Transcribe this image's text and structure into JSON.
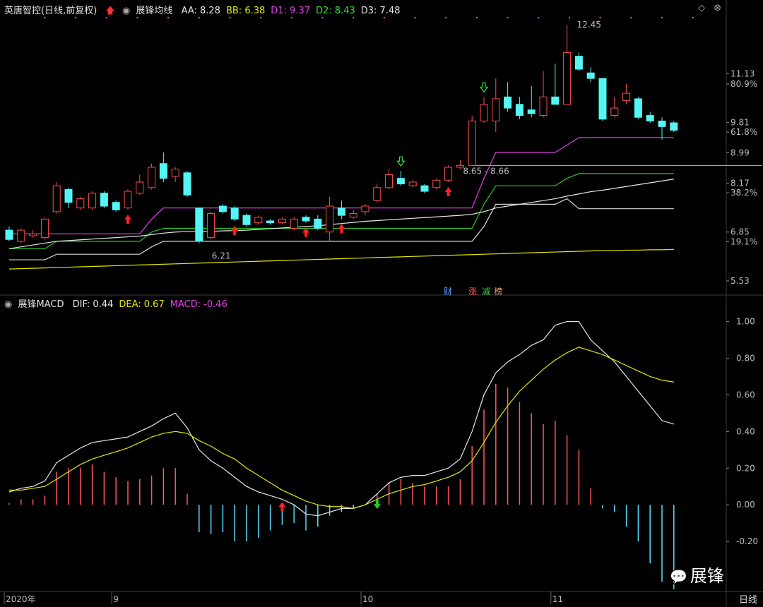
{
  "colors": {
    "bg": "#000000",
    "grid": "#3a3a3a",
    "up": "#ff4d4d",
    "down": "#54f5f5",
    "aa": "#e040e0",
    "bb": "#ffffff",
    "d1": "#e040e0",
    "d2": "#22cc22",
    "d3": "#d8d8d8",
    "dif": "#e6e6e6",
    "dea": "#e6e600",
    "macd_pos": "#ff5a5a",
    "macd_neg": "#54e0ff"
  },
  "header": {
    "stock": "英唐智控(日线,前复权)",
    "indicator": "展锋均线",
    "values": [
      {
        "label": "AA: 8.28",
        "color": "#e6e6e6"
      },
      {
        "label": "BB: 6.38",
        "color": "#e6e600"
      },
      {
        "label": "D1: 9.37",
        "color": "#e040e0"
      },
      {
        "label": "D2: 8.43",
        "color": "#33dd33"
      },
      {
        "label": "D3: 7.48",
        "color": "#e6e6e6"
      }
    ]
  },
  "macd_header": {
    "name": "展锋MACD",
    "values": [
      {
        "label": "DIF: 0.44",
        "color": "#e6e6e6"
      },
      {
        "label": "DEA: 0.67",
        "color": "#e6e600"
      },
      {
        "label": "MACD: -0.46",
        "color": "#e040e0"
      }
    ]
  },
  "price_axis": {
    "labels": [
      {
        "v": 11.13,
        "t": "11.13"
      },
      {
        "v": 10.85,
        "t": "80.9%"
      },
      {
        "v": 9.81,
        "t": "9.81"
      },
      {
        "v": 9.55,
        "t": "61.8%"
      },
      {
        "v": 8.99,
        "t": "8.99"
      },
      {
        "v": 8.17,
        "t": "8.17"
      },
      {
        "v": 7.91,
        "t": "38.2%"
      },
      {
        "v": 6.85,
        "t": "6.85"
      },
      {
        "v": 6.59,
        "t": "19.1%"
      },
      {
        "v": 5.53,
        "t": "5.53"
      }
    ]
  },
  "macd_axis": {
    "labels": [
      "1.00",
      "0.80",
      "0.60",
      "0.40",
      "0.20",
      "0.00",
      "-0.20"
    ],
    "values": [
      1.0,
      0.8,
      0.6,
      0.4,
      0.2,
      0.0,
      -0.2
    ]
  },
  "date_axis": [
    {
      "label": "2020年",
      "index": 0
    },
    {
      "label": "9",
      "index": 9
    },
    {
      "label": "10",
      "index": 30
    },
    {
      "label": "11",
      "index": 46
    }
  ],
  "period_label": "日线",
  "annotations": {
    "high": "12.45",
    "low": "6.21",
    "range": "8.65 - 8.66"
  },
  "badges": [
    {
      "text": "财",
      "color": "#5aa0ff"
    },
    {
      "text": "涨",
      "color": "#ff4d4d"
    },
    {
      "text": "减",
      "color": "#33dd33"
    },
    {
      "text": "榜",
      "color": "#e6a060"
    }
  ],
  "watermark": "展锋",
  "chart_data": [
    {
      "type": "candlestick",
      "title": "展锋均线",
      "ylim": [
        5.3,
        12.7
      ],
      "candles": [
        [
          6.9,
          6.65,
          7.0,
          6.6
        ],
        [
          6.6,
          6.9,
          6.95,
          6.55
        ],
        [
          6.75,
          6.8,
          6.9,
          6.7
        ],
        [
          6.7,
          7.2,
          7.25,
          6.65
        ],
        [
          7.4,
          8.1,
          8.2,
          7.35
        ],
        [
          8.0,
          7.65,
          8.05,
          7.5
        ],
        [
          7.5,
          7.75,
          7.8,
          7.45
        ],
        [
          7.5,
          7.9,
          7.95,
          7.45
        ],
        [
          7.9,
          7.55,
          7.95,
          7.5
        ],
        [
          7.65,
          7.45,
          7.7,
          7.4
        ],
        [
          7.5,
          7.95,
          8.0,
          7.45
        ],
        [
          7.9,
          8.2,
          8.4,
          7.85
        ],
        [
          8.05,
          8.6,
          8.7,
          8.0
        ],
        [
          8.7,
          8.3,
          9.0,
          8.2
        ],
        [
          8.35,
          8.55,
          8.6,
          8.2
        ],
        [
          8.45,
          7.85,
          8.5,
          7.8
        ],
        [
          7.5,
          6.6,
          7.5,
          6.55
        ],
        [
          6.7,
          7.35,
          7.4,
          6.65
        ],
        [
          7.55,
          7.4,
          7.6,
          7.35
        ],
        [
          7.5,
          7.2,
          7.55,
          7.15
        ],
        [
          7.3,
          7.05,
          7.35,
          7.0
        ],
        [
          7.1,
          7.25,
          7.3,
          7.05
        ],
        [
          7.15,
          7.1,
          7.2,
          7.05
        ],
        [
          7.1,
          7.2,
          7.25,
          7.05
        ],
        [
          6.95,
          7.2,
          7.25,
          6.9
        ],
        [
          7.25,
          7.15,
          7.3,
          7.1
        ],
        [
          7.2,
          6.95,
          7.3,
          6.9
        ],
        [
          6.85,
          7.55,
          7.8,
          6.6
        ],
        [
          7.5,
          7.3,
          7.7,
          7.2
        ],
        [
          7.25,
          7.35,
          7.45,
          7.2
        ],
        [
          7.4,
          7.55,
          7.6,
          7.3
        ],
        [
          7.7,
          8.05,
          8.15,
          7.65
        ],
        [
          8.05,
          8.4,
          8.55,
          8.0
        ],
        [
          8.3,
          8.15,
          8.5,
          8.1
        ],
        [
          8.1,
          8.2,
          8.25,
          8.05
        ],
        [
          8.1,
          7.95,
          8.15,
          7.9
        ],
        [
          8.05,
          8.25,
          8.3,
          8.0
        ],
        [
          8.25,
          8.6,
          8.65,
          8.2
        ],
        [
          8.6,
          8.65,
          8.8,
          8.55
        ],
        [
          8.65,
          9.85,
          10.0,
          8.65
        ],
        [
          9.85,
          10.3,
          10.5,
          9.8
        ],
        [
          9.85,
          10.45,
          11.0,
          9.55
        ],
        [
          10.5,
          10.2,
          10.9,
          10.1
        ],
        [
          10.3,
          10.0,
          10.5,
          9.9
        ],
        [
          10.15,
          10.05,
          10.8,
          9.95
        ],
        [
          10.0,
          10.5,
          11.2,
          9.95
        ],
        [
          10.5,
          10.3,
          11.4,
          10.3
        ],
        [
          10.3,
          11.7,
          12.45,
          10.3
        ],
        [
          11.6,
          11.25,
          11.7,
          11.2
        ],
        [
          11.15,
          11.0,
          11.3,
          10.9
        ],
        [
          11.0,
          9.9,
          11.0,
          9.85
        ],
        [
          10.0,
          10.2,
          10.5,
          9.95
        ],
        [
          10.4,
          10.6,
          10.85,
          10.3
        ],
        [
          10.45,
          9.95,
          10.5,
          9.9
        ],
        [
          10.0,
          9.85,
          10.1,
          9.8
        ],
        [
          9.85,
          9.7,
          9.95,
          9.35
        ],
        [
          9.8,
          9.6,
          9.85,
          9.55
        ]
      ],
      "series": [
        {
          "name": "D1",
          "color": "#e040e0",
          "values": [
            6.8,
            6.8,
            6.8,
            6.8,
            6.8,
            6.8,
            6.8,
            6.8,
            6.8,
            6.8,
            6.8,
            6.8,
            7.2,
            7.5,
            7.5,
            7.5,
            7.5,
            7.5,
            7.5,
            7.5,
            7.5,
            7.5,
            7.5,
            7.5,
            7.5,
            7.5,
            7.5,
            7.5,
            7.5,
            7.5,
            7.5,
            7.5,
            7.5,
            7.5,
            7.5,
            7.5,
            7.5,
            7.5,
            7.5,
            7.5,
            8.3,
            9.0,
            9.0,
            9.0,
            9.0,
            9.0,
            9.0,
            9.2,
            9.4,
            9.4,
            9.4,
            9.4,
            9.4,
            9.4,
            9.4,
            9.4,
            9.4
          ]
        },
        {
          "name": "D2",
          "color": "#22cc22",
          "values": [
            6.4,
            6.4,
            6.4,
            6.4,
            6.6,
            6.6,
            6.6,
            6.6,
            6.6,
            6.6,
            6.6,
            6.6,
            6.85,
            6.95,
            6.95,
            6.95,
            6.95,
            6.95,
            6.95,
            6.95,
            6.95,
            6.95,
            6.95,
            6.95,
            6.95,
            6.95,
            6.95,
            6.95,
            6.95,
            6.95,
            6.95,
            6.95,
            6.95,
            6.95,
            6.95,
            6.95,
            6.95,
            6.95,
            6.95,
            6.95,
            7.6,
            8.1,
            8.1,
            8.1,
            8.1,
            8.1,
            8.1,
            8.3,
            8.43,
            8.43,
            8.43,
            8.43,
            8.43,
            8.43,
            8.43,
            8.43,
            8.43
          ]
        },
        {
          "name": "D3",
          "color": "#d8d8d8",
          "values": [
            6.1,
            6.1,
            6.1,
            6.1,
            6.25,
            6.25,
            6.25,
            6.25,
            6.25,
            6.25,
            6.25,
            6.25,
            6.45,
            6.6,
            6.6,
            6.6,
            6.6,
            6.6,
            6.6,
            6.6,
            6.6,
            6.6,
            6.6,
            6.6,
            6.6,
            6.6,
            6.6,
            6.6,
            6.6,
            6.6,
            6.6,
            6.6,
            6.6,
            6.6,
            6.6,
            6.6,
            6.6,
            6.6,
            6.6,
            6.6,
            7.0,
            7.6,
            7.6,
            7.6,
            7.6,
            7.6,
            7.6,
            7.75,
            7.48,
            7.48,
            7.48,
            7.48,
            7.48,
            7.48,
            7.48,
            7.48,
            7.48
          ]
        },
        {
          "name": "AA",
          "color": "#e6e6e6",
          "values": [
            6.4,
            6.45,
            6.5,
            6.55,
            6.6,
            6.62,
            6.64,
            6.66,
            6.68,
            6.7,
            6.72,
            6.74,
            6.78,
            6.82,
            6.85,
            6.86,
            6.86,
            6.87,
            6.88,
            6.89,
            6.9,
            6.92,
            6.94,
            6.96,
            6.98,
            7.0,
            7.02,
            7.05,
            7.08,
            7.11,
            7.14,
            7.16,
            7.18,
            7.2,
            7.22,
            7.24,
            7.26,
            7.28,
            7.3,
            7.33,
            7.4,
            7.5,
            7.55,
            7.6,
            7.65,
            7.7,
            7.75,
            7.82,
            7.88,
            7.94,
            7.98,
            8.03,
            8.08,
            8.13,
            8.18,
            8.23,
            8.28
          ]
        },
        {
          "name": "BB",
          "color": "#e6e600",
          "values": [
            5.85,
            5.86,
            5.87,
            5.88,
            5.89,
            5.9,
            5.91,
            5.92,
            5.93,
            5.94,
            5.95,
            5.96,
            5.97,
            5.98,
            5.99,
            6.0,
            6.01,
            6.02,
            6.03,
            6.04,
            6.05,
            6.06,
            6.07,
            6.08,
            6.09,
            6.1,
            6.11,
            6.12,
            6.13,
            6.14,
            6.15,
            6.16,
            6.17,
            6.18,
            6.19,
            6.2,
            6.21,
            6.22,
            6.23,
            6.24,
            6.25,
            6.26,
            6.27,
            6.28,
            6.29,
            6.3,
            6.31,
            6.32,
            6.33,
            6.34,
            6.35,
            6.35,
            6.36,
            6.36,
            6.37,
            6.37,
            6.38
          ]
        }
      ],
      "up_arrows": [
        10,
        19,
        25,
        28,
        37
      ],
      "down_arrows": [
        40,
        33
      ]
    },
    {
      "type": "macd",
      "title": "展锋MACD",
      "ylim": [
        -0.45,
        1.06
      ],
      "series": [
        {
          "name": "DIF",
          "color": "#e6e6e6",
          "values": [
            0.07,
            0.09,
            0.1,
            0.13,
            0.23,
            0.27,
            0.31,
            0.34,
            0.35,
            0.36,
            0.37,
            0.4,
            0.43,
            0.47,
            0.5,
            0.42,
            0.3,
            0.24,
            0.2,
            0.15,
            0.1,
            0.07,
            0.05,
            0.03,
            0.0,
            -0.05,
            -0.06,
            -0.04,
            -0.02,
            -0.02,
            0.0,
            0.06,
            0.12,
            0.15,
            0.16,
            0.16,
            0.18,
            0.2,
            0.25,
            0.4,
            0.6,
            0.72,
            0.78,
            0.82,
            0.87,
            0.9,
            0.98,
            1.0,
            1.0,
            0.9,
            0.84,
            0.78,
            0.7,
            0.62,
            0.54,
            0.46,
            0.44
          ]
        },
        {
          "name": "DEA",
          "color": "#e6e600",
          "values": [
            0.08,
            0.08,
            0.09,
            0.1,
            0.14,
            0.18,
            0.22,
            0.25,
            0.27,
            0.29,
            0.31,
            0.34,
            0.37,
            0.39,
            0.4,
            0.39,
            0.35,
            0.32,
            0.28,
            0.25,
            0.2,
            0.16,
            0.12,
            0.08,
            0.05,
            0.02,
            0.0,
            -0.01,
            -0.01,
            -0.02,
            0.0,
            0.03,
            0.06,
            0.08,
            0.1,
            0.11,
            0.13,
            0.15,
            0.18,
            0.24,
            0.34,
            0.45,
            0.54,
            0.62,
            0.68,
            0.74,
            0.79,
            0.83,
            0.86,
            0.84,
            0.82,
            0.79,
            0.76,
            0.73,
            0.7,
            0.68,
            0.67
          ]
        },
        {
          "name": "MACD",
          "color": "#e040e0",
          "values": [
            0.01,
            0.03,
            0.03,
            0.05,
            0.18,
            0.2,
            0.2,
            0.22,
            0.18,
            0.15,
            0.13,
            0.14,
            0.16,
            0.2,
            0.2,
            0.06,
            -0.15,
            -0.16,
            -0.15,
            -0.2,
            -0.2,
            -0.18,
            -0.14,
            -0.11,
            -0.1,
            -0.14,
            -0.12,
            -0.06,
            -0.04,
            -0.02,
            0.0,
            0.06,
            0.12,
            0.14,
            0.12,
            0.1,
            0.1,
            0.1,
            0.14,
            0.32,
            0.52,
            0.66,
            0.64,
            0.56,
            0.5,
            0.44,
            0.46,
            0.38,
            0.3,
            0.09,
            -0.02,
            -0.04,
            -0.12,
            -0.2,
            -0.32,
            -0.42,
            -0.46
          ]
        }
      ]
    }
  ]
}
